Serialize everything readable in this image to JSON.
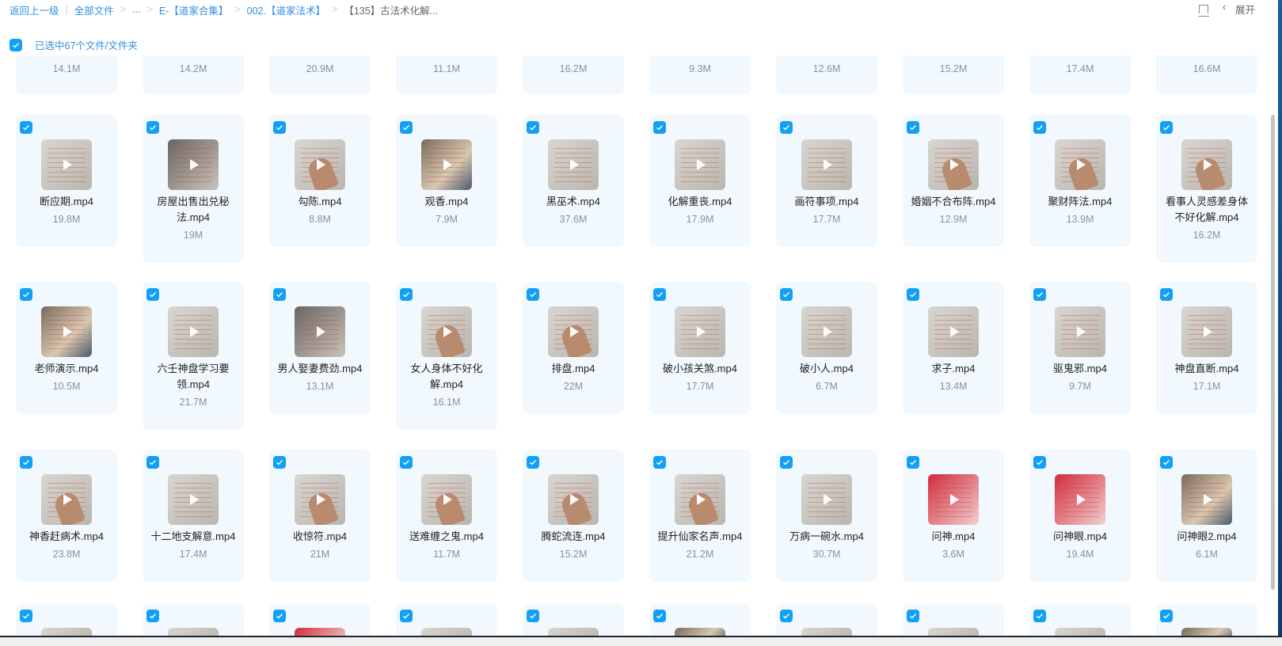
{
  "header": {
    "back": "返回上一级",
    "breadcrumb": [
      "全部文件",
      "...",
      "E-【道家合集】",
      "002.【道家法术】"
    ],
    "current": "【135】古法术化解...",
    "expand_label": "展开",
    "panel_icon": "panel-layout-icon",
    "chevron_icon": "chevron-left-icon"
  },
  "selection": {
    "label": "已选中67个文件/文件夹",
    "checked": true
  },
  "colors": {
    "accent": "#11a0f5",
    "link": "#2f8fe0",
    "card_bg": "#f1f9fe"
  },
  "rows": [
    {
      "partial": "top",
      "items": [
        {
          "size": "14.1M"
        },
        {
          "size": "14.2M"
        },
        {
          "size": "20.9M"
        },
        {
          "size": "11.1M"
        },
        {
          "size": "16.2M"
        },
        {
          "size": "9.3M"
        },
        {
          "size": "12.6M"
        },
        {
          "size": "15.2M"
        },
        {
          "size": "17.4M"
        },
        {
          "size": "16.6M"
        }
      ]
    },
    {
      "items": [
        {
          "name": "断应期.mp4",
          "size": "19.8M",
          "thumb": "paper"
        },
        {
          "name": "房屋出售出兑秘法.mp4",
          "size": "19M",
          "thumb": "dark"
        },
        {
          "name": "勾陈.mp4",
          "size": "8.8M",
          "thumb": "hand"
        },
        {
          "name": "观香.mp4",
          "size": "7.9M",
          "thumb": "photo"
        },
        {
          "name": "黑巫术.mp4",
          "size": "37.6M",
          "thumb": "paper"
        },
        {
          "name": "化解重丧.mp4",
          "size": "17.9M",
          "thumb": "paper"
        },
        {
          "name": "画符事项.mp4",
          "size": "17.7M",
          "thumb": "paper"
        },
        {
          "name": "婚姻不合布阵.mp4",
          "size": "12.9M",
          "thumb": "hand"
        },
        {
          "name": "聚财阵法.mp4",
          "size": "13.9M",
          "thumb": "hand"
        },
        {
          "name": "看事人灵感差身体不好化解.mp4",
          "size": "16.2M",
          "thumb": "hand"
        }
      ]
    },
    {
      "items": [
        {
          "name": "老师演示.mp4",
          "size": "10.5M",
          "thumb": "photo"
        },
        {
          "name": "六壬神盘学习要领.mp4",
          "size": "21.7M",
          "thumb": "paper"
        },
        {
          "name": "男人娶妻费劲.mp4",
          "size": "13.1M",
          "thumb": "dark"
        },
        {
          "name": "女人身体不好化解.mp4",
          "size": "16.1M",
          "thumb": "hand"
        },
        {
          "name": "排盘.mp4",
          "size": "22M",
          "thumb": "hand"
        },
        {
          "name": "破小孩关煞.mp4",
          "size": "17.7M",
          "thumb": "paper"
        },
        {
          "name": "破小人.mp4",
          "size": "6.7M",
          "thumb": "paper"
        },
        {
          "name": "求子.mp4",
          "size": "13.4M",
          "thumb": "paper"
        },
        {
          "name": "驱鬼邪.mp4",
          "size": "9.7M",
          "thumb": "paper"
        },
        {
          "name": "神盘直断.mp4",
          "size": "17.1M",
          "thumb": "paper"
        }
      ]
    },
    {
      "items": [
        {
          "name": "神香赶病术.mp4",
          "size": "23.8M",
          "thumb": "hand"
        },
        {
          "name": "十二地支解意.mp4",
          "size": "17.4M",
          "thumb": "paper"
        },
        {
          "name": "收惊符.mp4",
          "size": "21M",
          "thumb": "hand"
        },
        {
          "name": "送难缠之鬼.mp4",
          "size": "11.7M",
          "thumb": "hand"
        },
        {
          "name": "腾蛇流连.mp4",
          "size": "15.2M",
          "thumb": "hand"
        },
        {
          "name": "提升仙家名声.mp4",
          "size": "21.2M",
          "thumb": "hand"
        },
        {
          "name": "万病一碗水.mp4",
          "size": "30.7M",
          "thumb": "paper"
        },
        {
          "name": "问神.mp4",
          "size": "3.6M",
          "thumb": "red"
        },
        {
          "name": "问神眼.mp4",
          "size": "19.4M",
          "thumb": "red"
        },
        {
          "name": "问神眼2.mp4",
          "size": "6.1M",
          "thumb": "photo"
        }
      ]
    },
    {
      "partial": "bottom",
      "items": [
        {
          "thumb": "paper"
        },
        {
          "thumb": "paper"
        },
        {
          "thumb": "red"
        },
        {
          "thumb": "paper"
        },
        {
          "thumb": "paper"
        },
        {
          "thumb": "photo"
        },
        {
          "thumb": "paper"
        },
        {
          "thumb": "hand"
        },
        {
          "thumb": "paper"
        },
        {
          "thumb": "photo"
        }
      ]
    }
  ]
}
